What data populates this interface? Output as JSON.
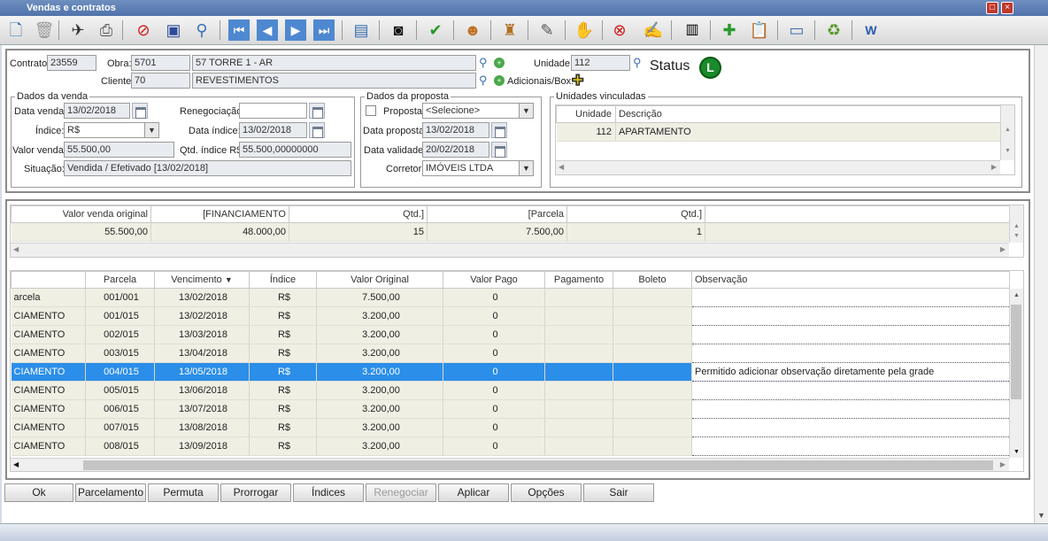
{
  "window": {
    "title": "Vendas e contratos"
  },
  "header": {
    "contrato_label": "Contrato:",
    "contrato": "23559",
    "obra_label": "Obra:",
    "obra_code": "5701",
    "obra_name": "57  TORRE 1 - AR",
    "cliente_label": "Cliente:",
    "cliente_code": "70",
    "cliente_name": "REVESTIMENTOS",
    "unidade_label": "Unidade:",
    "unidade": "112",
    "adicionais_label": "Adicionais/Box:",
    "status_label": "Status",
    "status_badge": "L"
  },
  "venda": {
    "group_title": "Dados da venda",
    "data_venda_label": "Data venda:",
    "data_venda": "13/02/2018",
    "renegociacao_label": "Renegociação:",
    "renegociacao": "",
    "indice_label": "Índice:",
    "indice": "R$",
    "data_indice_label": "Data índice:",
    "data_indice": "13/02/2018",
    "valor_venda_label": "Valor venda:",
    "valor_venda": "55.500,00",
    "qtd_indice_label": "Qtd. índice R$",
    "qtd_indice": "55.500,00000000",
    "situacao_label": "Situação:",
    "situacao": "Vendida / Efetivado [13/02/2018]"
  },
  "proposta": {
    "group_title": "Dados da proposta",
    "proposta_label": "Proposta:",
    "proposta": "<Selecione>",
    "data_proposta_label": "Data proposta:",
    "data_proposta": "13/02/2018",
    "data_validade_label": "Data validade:",
    "data_validade": "20/02/2018",
    "corretor_label": "Corretor:",
    "corretor": "IMÓVEIS LTDA"
  },
  "unidades": {
    "group_title": "Unidades vinculadas",
    "headers": [
      "Unidade",
      "Descrição"
    ],
    "rows": [
      {
        "unidade": "112",
        "descricao": "APARTAMENTO"
      }
    ]
  },
  "summary": {
    "headers": [
      "Valor venda original",
      "[FINANCIAMENTO",
      "Qtd.]",
      "[Parcela",
      "Qtd.]"
    ],
    "values": [
      "55.500,00",
      "48.000,00",
      "15",
      "7.500,00",
      "1"
    ]
  },
  "parcelas": {
    "headers": [
      "",
      "Parcela",
      "Vencimento",
      "Índice",
      "Valor Original",
      "Valor Pago",
      "Pagamento",
      "Boleto",
      "Observação"
    ],
    "rows": [
      [
        "arcela",
        "001/001",
        "13/02/2018",
        "R$",
        "7.500,00",
        "0",
        "",
        "",
        ""
      ],
      [
        "CIAMENTO",
        "001/015",
        "13/02/2018",
        "R$",
        "3.200,00",
        "0",
        "",
        "",
        ""
      ],
      [
        "CIAMENTO",
        "002/015",
        "13/03/2018",
        "R$",
        "3.200,00",
        "0",
        "",
        "",
        ""
      ],
      [
        "CIAMENTO",
        "003/015",
        "13/04/2018",
        "R$",
        "3.200,00",
        "0",
        "",
        "",
        ""
      ],
      [
        "CIAMENTO",
        "004/015",
        "13/05/2018",
        "R$",
        "3.200,00",
        "0",
        "",
        "",
        "Permitido adicionar observação diretamente pela grade"
      ],
      [
        "CIAMENTO",
        "005/015",
        "13/06/2018",
        "R$",
        "3.200,00",
        "0",
        "",
        "",
        ""
      ],
      [
        "CIAMENTO",
        "006/015",
        "13/07/2018",
        "R$",
        "3.200,00",
        "0",
        "",
        "",
        ""
      ],
      [
        "CIAMENTO",
        "007/015",
        "13/08/2018",
        "R$",
        "3.200,00",
        "0",
        "",
        "",
        ""
      ],
      [
        "CIAMENTO",
        "008/015",
        "13/09/2018",
        "R$",
        "3.200,00",
        "0",
        "",
        "",
        ""
      ]
    ],
    "selected_index": 4
  },
  "buttons": [
    "Ok",
    "Parcelamento",
    "Permuta",
    "Prorrogar",
    "Índices",
    "Renegociar",
    "Aplicar",
    "Opções",
    "Sair"
  ],
  "toolbar": {
    "icons": [
      "new-document-icon",
      "trash-icon",
      "run-icon",
      "print-icon",
      "cancel-icon",
      "save-icon",
      "search-icon",
      "first-icon",
      "previous-icon",
      "next-icon",
      "last-icon",
      "report-icon",
      "camera-icon",
      "check-icon",
      "users-icon",
      "money-bag-icon",
      "signature-icon",
      "handshake-icon",
      "no-sign-icon",
      "edit-document-icon",
      "barcode-icon",
      "add-item-icon",
      "clipboard-icon",
      "card-icon",
      "recycle-icon",
      "word-icon"
    ]
  }
}
